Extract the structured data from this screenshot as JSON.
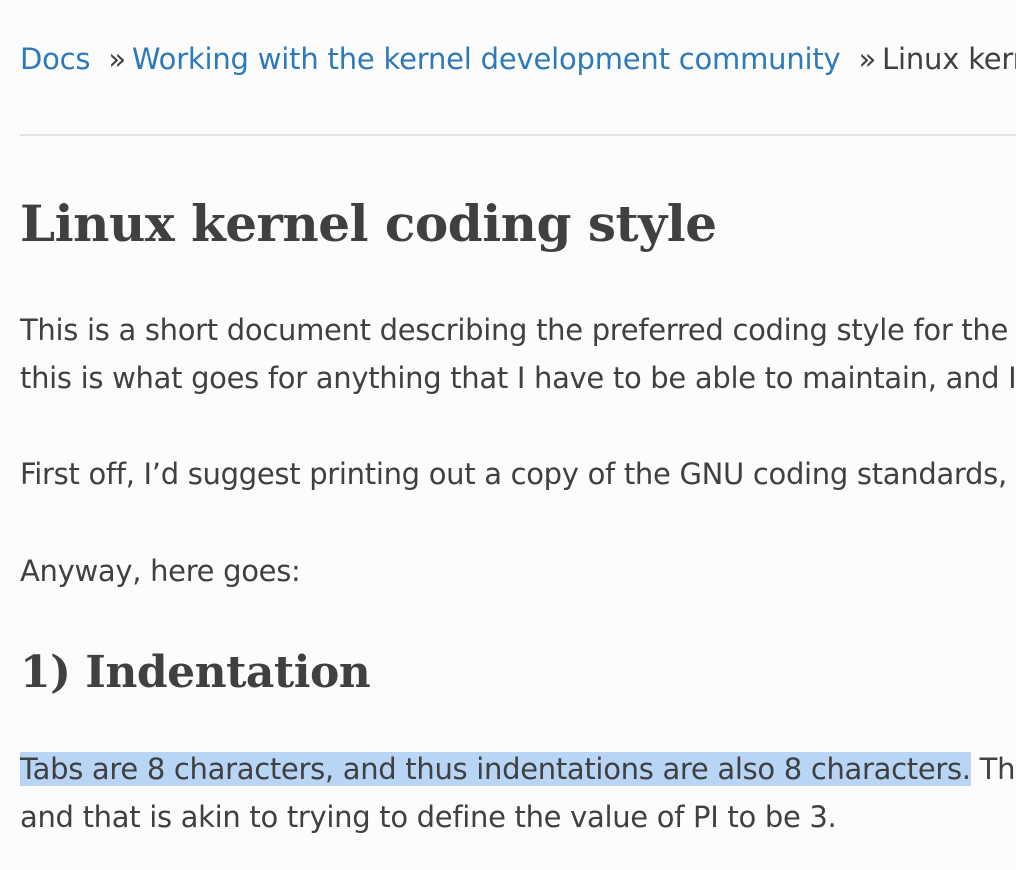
{
  "breadcrumb": {
    "items": [
      "Docs",
      "Working with the kernel development community"
    ],
    "separator": "»",
    "current": "Linux kerne"
  },
  "title": "Linux kernel coding style",
  "intro": {
    "line1": "This is a short document describing the preferred coding style for the lin",
    "line2": "this is what goes for anything that I have to be able to maintain, and I’d"
  },
  "para2": "First off, I’d suggest printing out a copy of the GNU coding standards, an",
  "para3": "Anyway, here goes:",
  "section": {
    "heading": "1) Indentation",
    "selected_text": "Tabs are 8 characters, and thus indentations are also 8 characters.",
    "line1_rest": " There",
    "line2": "and that is akin to trying to define the value of PI to be 3."
  },
  "colors": {
    "link": "#2e79b9",
    "text": "#404040",
    "selection": "#b9d5f6",
    "rule": "#e1e4e5"
  }
}
